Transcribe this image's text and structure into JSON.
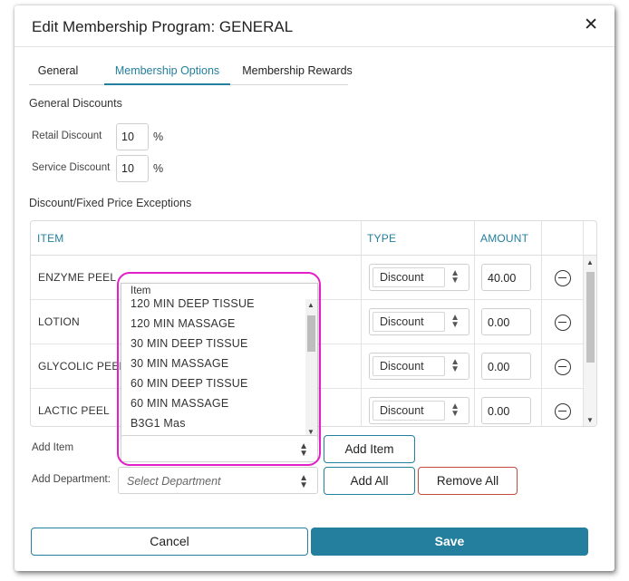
{
  "modal": {
    "title": "Edit Membership Program: GENERAL",
    "close_glyph": "✕"
  },
  "tabs": [
    {
      "label": "General",
      "active": false
    },
    {
      "label": "Membership Options",
      "active": true
    },
    {
      "label": "Membership Rewards",
      "active": false
    }
  ],
  "general_discounts": {
    "heading": "General Discounts",
    "retail": {
      "label": "Retail Discount",
      "value": "10",
      "unit": "%"
    },
    "service": {
      "label": "Service Discount",
      "value": "10",
      "unit": "%"
    }
  },
  "exceptions": {
    "heading": "Discount/Fixed Price Exceptions",
    "columns": {
      "item": "ITEM",
      "type": "TYPE",
      "amount": "AMOUNT"
    },
    "rows": [
      {
        "item": "ENZYME PEEL",
        "type": "Discount",
        "amount": "40.00"
      },
      {
        "item": "LOTION",
        "type": "Discount",
        "amount": "0.00"
      },
      {
        "item": "GLYCOLIC PEEL",
        "type": "Discount",
        "amount": "0.00"
      },
      {
        "item": "LACTIC PEEL",
        "type": "Discount",
        "amount": "0.00"
      }
    ]
  },
  "item_dropdown": {
    "header": "Item",
    "options": [
      "120 MIN DEEP TISSUE",
      "120 MIN MASSAGE",
      "30 MIN DEEP TISSUE",
      "30 MIN MASSAGE",
      "60 MIN DEEP TISSUE",
      "60 MIN MASSAGE",
      "B3G1 Mas"
    ]
  },
  "add_item": {
    "label": "Add Item",
    "button": "Add Item"
  },
  "add_department": {
    "label": "Add Department:",
    "placeholder": "Select Department",
    "add_all": "Add All",
    "remove_all": "Remove All"
  },
  "footer": {
    "cancel": "Cancel",
    "save": "Save"
  },
  "colors": {
    "accent": "#247f9e",
    "primary_button": "#237f9d",
    "danger_border": "#c44b3c",
    "highlight": "#e21fc8"
  },
  "icons": {
    "close": "close-icon",
    "chevron": "chevron-updown-icon",
    "remove_row": "minus-circle-icon"
  }
}
